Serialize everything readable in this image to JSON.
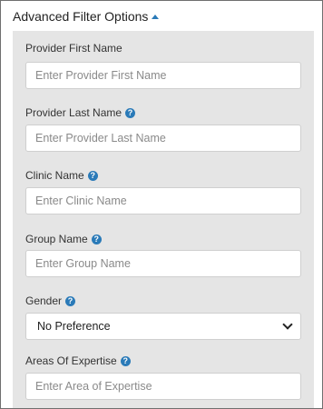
{
  "header": {
    "title": "Advanced Filter Options"
  },
  "fields": {
    "provider_first_name": {
      "label": "Provider First Name",
      "placeholder": "Enter Provider First Name"
    },
    "provider_last_name": {
      "label": "Provider Last Name",
      "placeholder": "Enter Provider Last Name"
    },
    "clinic_name": {
      "label": "Clinic Name",
      "placeholder": "Enter Clinic Name"
    },
    "group_name": {
      "label": "Group Name",
      "placeholder": "Enter Group Name"
    },
    "gender": {
      "label": "Gender",
      "selected": "No Preference"
    },
    "areas_of_expertise": {
      "label": "Areas Of Expertise",
      "placeholder": "Enter Area of Expertise"
    }
  },
  "help_glyph": "?",
  "colors": {
    "accent": "#2a7ab8",
    "panel_bg": "#e5e5e5"
  }
}
